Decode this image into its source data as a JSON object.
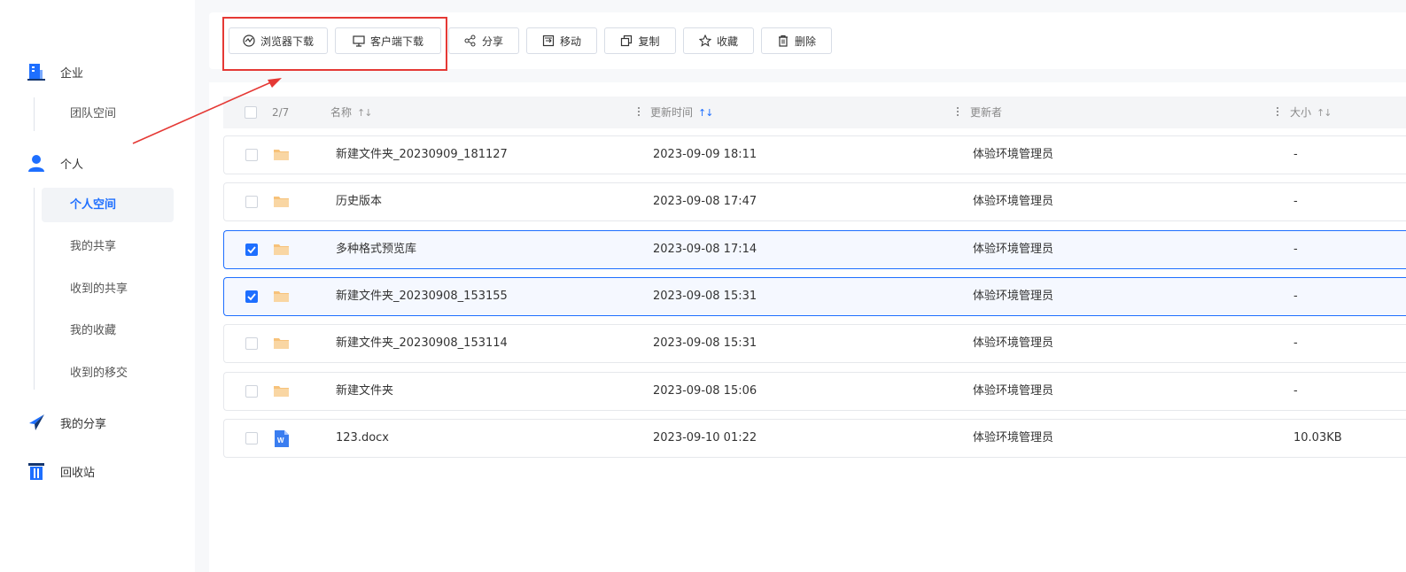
{
  "sidebar": {
    "enterprise": {
      "label": "企业",
      "icon": "building-icon"
    },
    "team_space": "团队空间",
    "personal": {
      "label": "个人",
      "icon": "user-icon"
    },
    "personal_items": [
      "个人空间",
      "我的共享",
      "收到的共享",
      "我的收藏",
      "收到的移交"
    ],
    "active_item": "个人空间",
    "my_share": {
      "label": "我的分享",
      "icon": "paper-plane-icon"
    },
    "recycle": {
      "label": "回收站",
      "icon": "trash-bin-icon"
    }
  },
  "toolbar": {
    "browser_download": "浏览器下载",
    "client_download": "客户端下载",
    "share": "分享",
    "move": "移动",
    "copy": "复制",
    "favorite": "收藏",
    "delete": "删除"
  },
  "table": {
    "count": "2/7",
    "columns": {
      "name": "名称",
      "updated": "更新时间",
      "updater": "更新者",
      "size": "大小"
    },
    "rows": [
      {
        "name": "新建文件夹_20230909_181127",
        "time": "2023-09-09 18:11",
        "updater": "体验环境管理员",
        "size": "-",
        "type": "folder",
        "checked": false
      },
      {
        "name": "历史版本",
        "time": "2023-09-08 17:47",
        "updater": "体验环境管理员",
        "size": "-",
        "type": "folder",
        "checked": false
      },
      {
        "name": "多种格式预览库",
        "time": "2023-09-08 17:14",
        "updater": "体验环境管理员",
        "size": "-",
        "type": "folder",
        "checked": true
      },
      {
        "name": "新建文件夹_20230908_153155",
        "time": "2023-09-08 15:31",
        "updater": "体验环境管理员",
        "size": "-",
        "type": "folder",
        "checked": true
      },
      {
        "name": "新建文件夹_20230908_153114",
        "time": "2023-09-08 15:31",
        "updater": "体验环境管理员",
        "size": "-",
        "type": "folder",
        "checked": false
      },
      {
        "name": "新建文件夹",
        "time": "2023-09-08 15:06",
        "updater": "体验环境管理员",
        "size": "-",
        "type": "folder",
        "checked": false
      },
      {
        "name": "123.docx",
        "time": "2023-09-10 01:22",
        "updater": "体验环境管理员",
        "size": "10.03KB",
        "type": "docx",
        "checked": false
      }
    ]
  },
  "colors": {
    "accent": "#1e6fff",
    "annotation": "#e53935",
    "folder": "#f7c27a"
  }
}
